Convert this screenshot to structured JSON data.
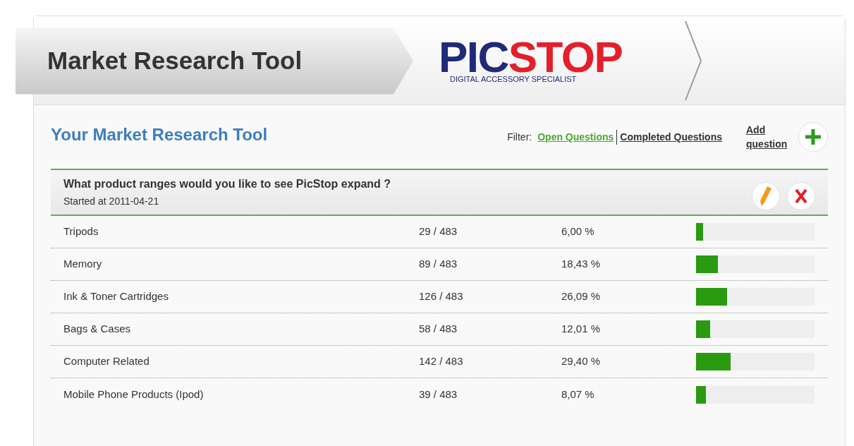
{
  "header": {
    "title": "Market Research Tool",
    "logo": {
      "part_1": "PIC",
      "part_2": "STOP",
      "tagline": "DIGITAL ACCESSORY SPECIALIST"
    }
  },
  "page_title": "Your Market Research Tool",
  "filter": {
    "label": "Filter:",
    "options": [
      {
        "label": "Open Questions",
        "selected": true
      },
      {
        "label": "Completed Questions",
        "selected": false
      }
    ]
  },
  "add_question": {
    "label": "Add question"
  },
  "question": {
    "title": "What product ranges would you like to see PicStop expand ?",
    "started": "Started at 2011-04-21"
  },
  "answers": [
    {
      "name": "Tripods",
      "count": "29 / 483",
      "percent": "6,00 %",
      "level": 0.06
    },
    {
      "name": "Memory",
      "count": "89 / 483",
      "percent": "18,43 %",
      "level": 0.1843
    },
    {
      "name": "Ink & Toner Cartridges",
      "count": "126 / 483",
      "percent": "26,09 %",
      "level": 0.2609
    },
    {
      "name": "Bags & Cases",
      "count": "58 / 483",
      "percent": "12,01 %",
      "level": 0.1201
    },
    {
      "name": "Computer Related",
      "count": "142 / 483",
      "percent": "29,40 %",
      "level": 0.294
    },
    {
      "name": "Mobile Phone Products (Ipod)",
      "count": "39 / 483",
      "percent": "8,07 %",
      "level": 0.0807
    }
  ]
}
